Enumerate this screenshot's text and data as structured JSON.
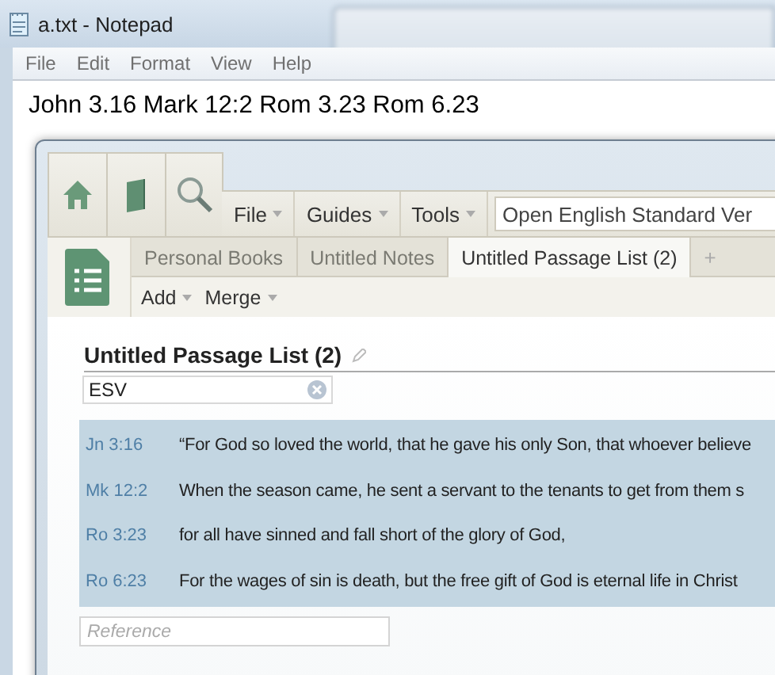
{
  "notepad": {
    "title": "a.txt - Notepad",
    "menu": [
      "File",
      "Edit",
      "Format",
      "View",
      "Help"
    ],
    "text": "John 3.16 Mark 12:2 Rom 3.23 Rom 6.23"
  },
  "logos": {
    "menus": [
      "File",
      "Guides",
      "Tools"
    ],
    "search_field": {
      "value": "Open English Standard Ver"
    },
    "tabs": [
      {
        "label": "Personal Books",
        "selected": false
      },
      {
        "label": "Untitled Notes",
        "selected": false
      },
      {
        "label": "Untitled Passage List (2)",
        "selected": true
      }
    ],
    "new_tab": "+",
    "actions": [
      "Add",
      "Merge"
    ],
    "list": {
      "title": "Untitled Passage List (2)",
      "filter": {
        "value": "ESV"
      },
      "rows": [
        {
          "reference": "Jn 3:16",
          "text": "“For God so loved the world, that he gave his only Son, that whoever believe"
        },
        {
          "reference": "Mk 12:2",
          "text": "When the season came, he sent a servant to the tenants to get from them s"
        },
        {
          "reference": "Ro 3:23",
          "text": "for all have sinned and fall short of the glory of God,"
        },
        {
          "reference": "Ro 6:23",
          "text": "For the wages of sin is death, but the free gift of God is eternal life in Christ"
        }
      ],
      "reference_field": {
        "placeholder": "Reference"
      }
    }
  }
}
